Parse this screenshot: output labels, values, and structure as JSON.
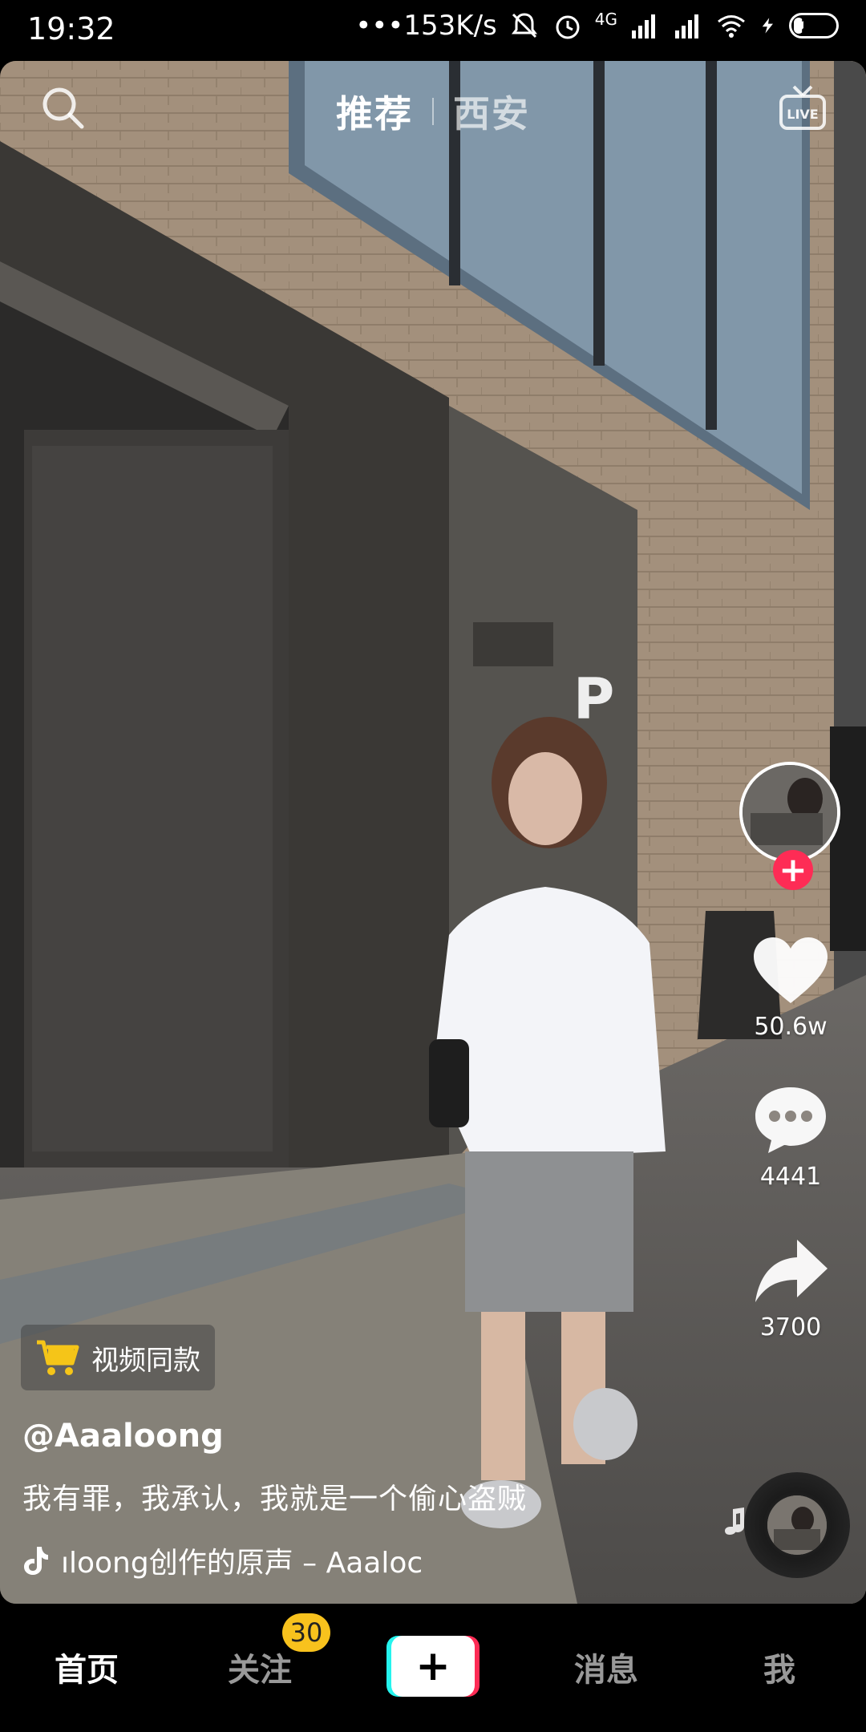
{
  "status_bar": {
    "time": "19:32",
    "net_speed": "•••153K/s",
    "network_label": "4G",
    "battery": "24",
    "battery_level_pct": 24
  },
  "top_tabs": {
    "recommend": "推荐",
    "local": "西安",
    "search_icon": "search-icon",
    "live_icon": "live-icon"
  },
  "actions": {
    "likes": "50.6w",
    "comments": "4441",
    "shares": "3700",
    "follow_symbol": "+"
  },
  "video": {
    "shop_label": "视频同款",
    "username": "@Aaaloong",
    "caption": "我有罪，我承认，我就是一个偷心盗贼",
    "music": "ıloong创作的原声 – Aaaloc"
  },
  "bottom_nav": {
    "home": "首页",
    "following": "关注",
    "following_badge": "30",
    "add": "+",
    "messages": "消息",
    "me": "我"
  },
  "colors": {
    "accent_red": "#fe2c55",
    "accent_cyan": "#25f4ee",
    "badge_yellow": "#f8c21d",
    "cart_yellow": "#f5c518"
  }
}
